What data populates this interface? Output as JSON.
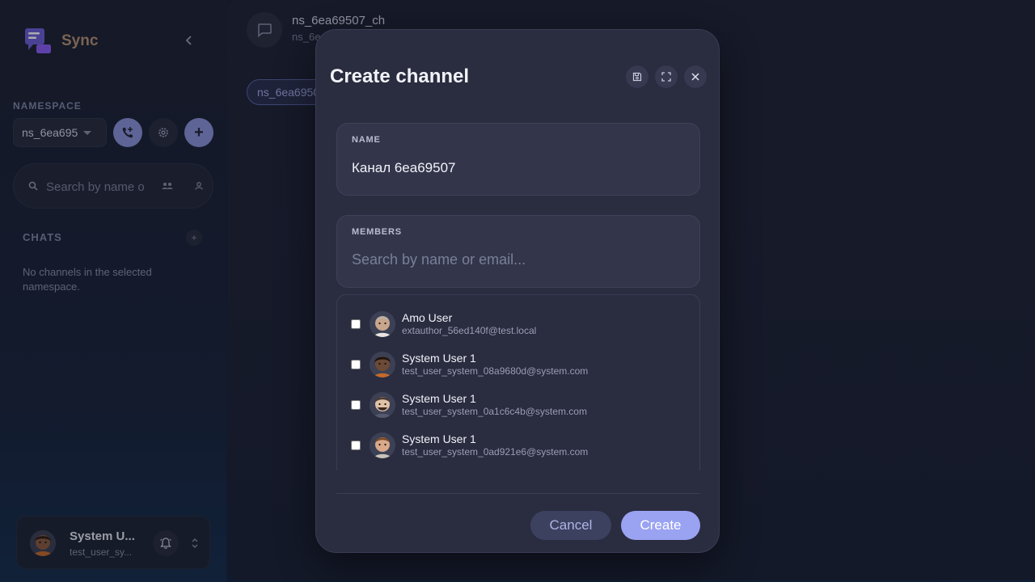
{
  "sidebar": {
    "brand_name": "Sync",
    "namespace_label": "NAMESPACE",
    "namespace_value": "ns_6ea695",
    "search_placeholder": "Search by name o",
    "chats_label": "CHATS",
    "chats_add": "+",
    "empty_text": "No channels in the selected namespace.",
    "plus_label": "+",
    "user": {
      "name": "System U...",
      "email": "test_user_sy..."
    }
  },
  "main": {
    "channel_title": "ns_6ea69507_ch",
    "channel_subtitle": "ns_6e",
    "chip_label": "ns_6ea6950",
    "empty_hint": ""
  },
  "modal": {
    "title": "Create channel",
    "name_label": "NAME",
    "name_value": "Канал 6ea69507",
    "members_label": "MEMBERS",
    "members_placeholder": "Search by name or email...",
    "members": [
      {
        "name": "Amo User",
        "email": "extauthor_56ed140f@test.local",
        "avatar_color": "#c9a58c"
      },
      {
        "name": "System User 1",
        "email": "test_user_system_08a9680d@system.com",
        "avatar_color": "#6b4a36"
      },
      {
        "name": "System User 1",
        "email": "test_user_system_0a1c6c4b@system.com",
        "avatar_color": "#4a3a32"
      },
      {
        "name": "System User 1",
        "email": "test_user_system_0ad921e6@system.com",
        "avatar_color": "#d9a98a"
      }
    ],
    "cancel_label": "Cancel",
    "create_label": "Create"
  },
  "colors": {
    "accent": "#9aa2f2",
    "brand_text": "#b69277",
    "modal_bg": "#2a2c40"
  }
}
